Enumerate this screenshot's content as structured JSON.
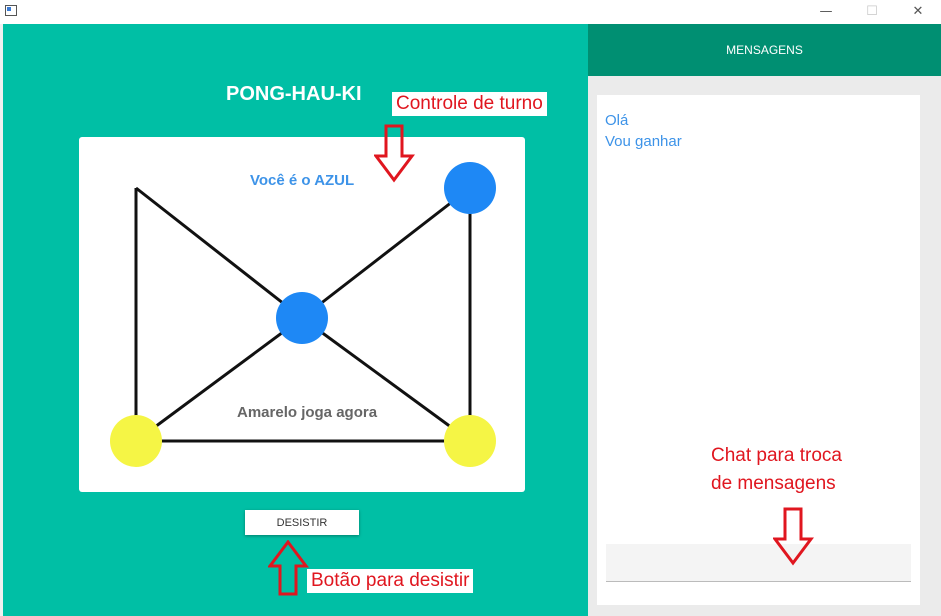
{
  "window": {
    "minimize_glyph": "—",
    "maximize_glyph": "☐",
    "close_glyph": "✕"
  },
  "game": {
    "title": "PONG-HAU-KI",
    "turn_label": "Você é o AZUL",
    "status_label": "Amarelo joga agora",
    "giveup_label": "DESISTIR",
    "colors": {
      "background": "#00bfa5",
      "blue_piece": "#1e88f5",
      "yellow_piece": "#f5f545"
    },
    "pieces": [
      {
        "node": "top-right",
        "color": "blue"
      },
      {
        "node": "center",
        "color": "blue"
      },
      {
        "node": "bottom-left",
        "color": "yellow"
      },
      {
        "node": "bottom-right",
        "color": "yellow"
      }
    ]
  },
  "chat": {
    "header": "MENSAGENS",
    "messages": [
      "Olá",
      "Vou ganhar"
    ],
    "input_value": "",
    "colors": {
      "header": "#008f72",
      "text": "#3d93e8"
    }
  },
  "annotations": {
    "turn_control": "Controle de turno",
    "giveup_button": "Botão para desistir",
    "chat_line1": "Chat para troca",
    "chat_line2": "de mensagens",
    "color": "#e0161f"
  }
}
